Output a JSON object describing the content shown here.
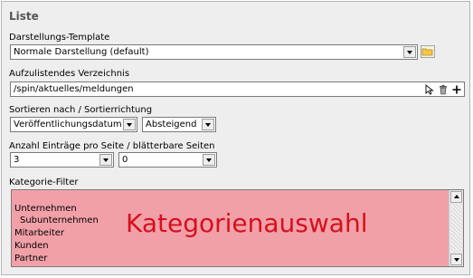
{
  "section": {
    "title": "Liste"
  },
  "template": {
    "label": "Darstellungs-Template",
    "value": "Normale Darstellung (default)"
  },
  "directory": {
    "label": "Aufzulistendes Verzeichnis",
    "value": "/spin/aktuelles/meldungen"
  },
  "sort": {
    "label": "Sortieren nach / Sortierrichtung",
    "by_value": "Veröffentlichungsdatum",
    "direction_value": "Absteigend"
  },
  "paging": {
    "label": "Anzahl Einträge pro Seite / blätterbare Seiten",
    "entries_value": "3",
    "pages_value": "0"
  },
  "category_filter": {
    "label": "Kategorie-Filter",
    "overlay_text": "Kategorienauswahl",
    "items": [
      "Unternehmen",
      "Subunternehmen",
      "Mitarbeiter",
      "Kunden",
      "Partner"
    ],
    "highlight_color": "#f2a0a8",
    "overlay_color": "#d4101e"
  },
  "icons": {
    "folder": "folder-icon",
    "cursor": "select-cursor-icon",
    "trash": "trash-icon",
    "add": "plus-icon"
  }
}
